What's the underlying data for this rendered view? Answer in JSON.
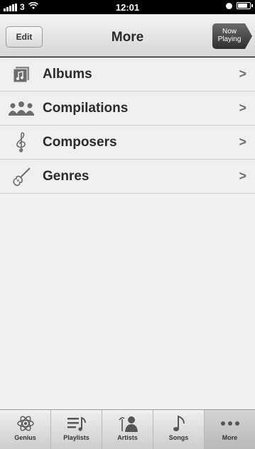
{
  "status_bar": {
    "carrier": "3",
    "time": "12:01",
    "battery_level": 0.85
  },
  "nav": {
    "edit_label": "Edit",
    "title": "More",
    "now_playing_line1": "Now",
    "now_playing_line2": "Playing"
  },
  "list": {
    "items": [
      {
        "label": "Albums",
        "icon": "album-icon"
      },
      {
        "label": "Compilations",
        "icon": "compilations-icon"
      },
      {
        "label": "Composers",
        "icon": "treble-clef-icon"
      },
      {
        "label": "Genres",
        "icon": "guitar-icon"
      }
    ]
  },
  "tab_bar": {
    "tabs": [
      {
        "label": "Genius",
        "icon": "atom-icon",
        "active": false
      },
      {
        "label": "Playlists",
        "icon": "playlist-icon",
        "active": false
      },
      {
        "label": "Artists",
        "icon": "artist-icon",
        "active": false
      },
      {
        "label": "Songs",
        "icon": "music-note-icon",
        "active": false
      },
      {
        "label": "More",
        "icon": "more-dots-icon",
        "active": true
      }
    ]
  }
}
